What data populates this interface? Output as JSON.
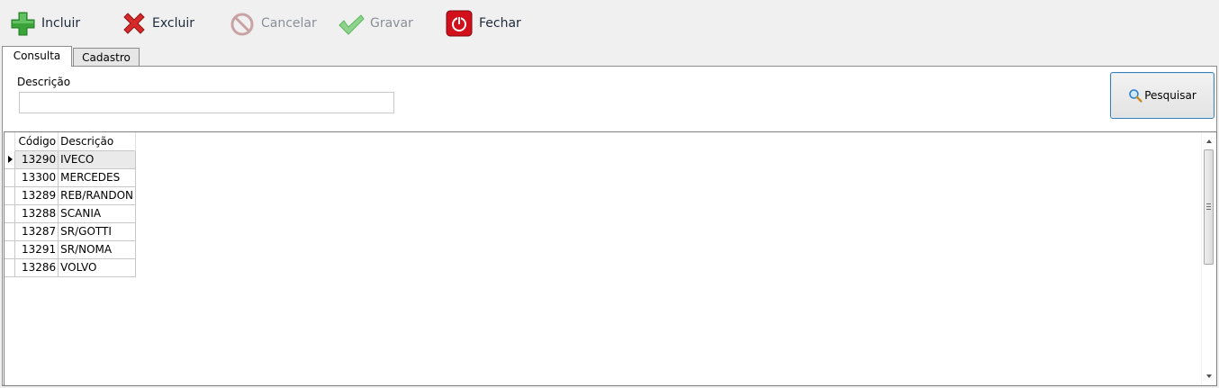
{
  "toolbar": {
    "incluir": "Incluir",
    "excluir": "Excluir",
    "cancelar": "Cancelar",
    "gravar": "Gravar",
    "fechar": "Fechar"
  },
  "tabs": [
    "Consulta",
    "Cadastro"
  ],
  "filter": {
    "label": "Descrição",
    "value": "",
    "search_button": "Pesquisar"
  },
  "grid": {
    "columns": [
      "Código",
      "Descrição"
    ],
    "selected_index": 0,
    "rows": [
      {
        "codigo": "13290",
        "descricao": "IVECO"
      },
      {
        "codigo": "13300",
        "descricao": "MERCEDES"
      },
      {
        "codigo": "13289",
        "descricao": "REB/RANDON"
      },
      {
        "codigo": "13288",
        "descricao": "SCANIA"
      },
      {
        "codigo": "13287",
        "descricao": "SR/GOTTI"
      },
      {
        "codigo": "13291",
        "descricao": "SR/NOMA"
      },
      {
        "codigo": "13286",
        "descricao": "VOLVO"
      }
    ]
  },
  "icons": {
    "incluir": "plus-icon",
    "excluir": "x-icon",
    "cancelar": "cancel-icon",
    "gravar": "check-icon",
    "fechar": "power-icon",
    "pesquisar": "magnifier-icon"
  },
  "colors": {
    "plus": "#3aa33a",
    "delete": "#d62a2a",
    "cancel": "#c9a3a3",
    "check": "#5cb85c",
    "close": "#d1101b",
    "search_border": "#3c7fb1"
  }
}
